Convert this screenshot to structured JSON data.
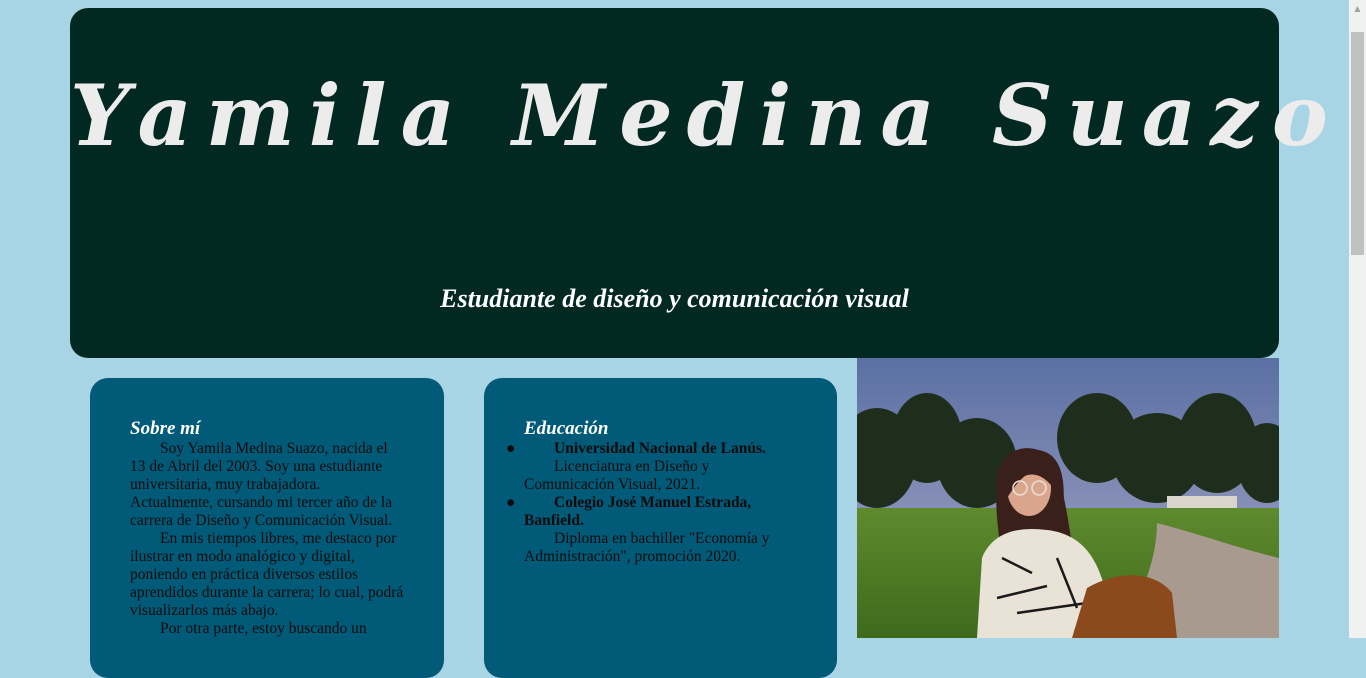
{
  "header": {
    "logo_text": "Yamila Medina Suazo",
    "subtitle": "Estudiante de diseño y comunicación visual"
  },
  "about": {
    "title": "Sobre mí",
    "paragraphs": [
      "Soy Yamila Medina Suazo, nacida el 13 de Abril del 2003. Soy una estudiante universitaria, muy trabajadora. Actualmente, cursando mi tercer año de la carrera de Diseño y Comunicación Visual.",
      "En mis tiempos libres, me destaco por ilustrar en modo analógico y digital, poniendo en práctica diversos estilos aprendidos durante la carrera; lo cual, podrá visualizarlos más abajo.",
      "Por otra parte, estoy buscando un"
    ]
  },
  "education": {
    "title": "Educación",
    "items": [
      {
        "institution": "Universidad Nacional de Lanús.",
        "detail": "Licenciatura en Diseño y Comunicación Visual, 2021."
      },
      {
        "institution": "Colegio José Manuel Estrada, Banfield.",
        "detail": "Diploma en bachiller \"Economía y Administración\", promoción 2020."
      }
    ]
  },
  "colors": {
    "page_background": "#a8d5e6",
    "header_background": "#012821",
    "card_background": "#005a78",
    "heading_text": "#ffffff"
  },
  "icons": {
    "list_bullet": "bullet-icon",
    "scroll_up": "scroll-up-arrow-icon"
  }
}
